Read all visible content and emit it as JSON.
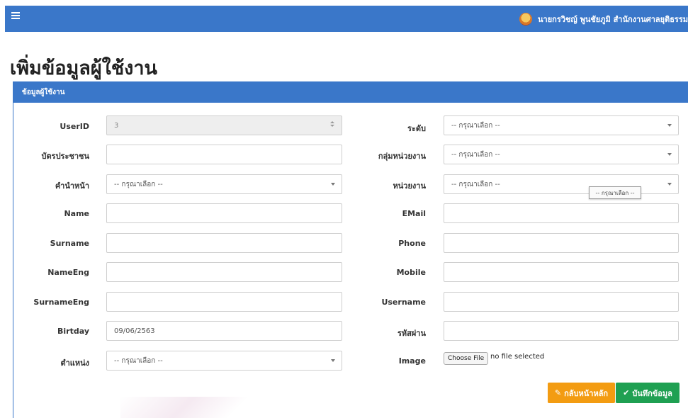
{
  "topbar": {
    "menu_icon": "hamburger-icon",
    "user_name": "นายกรวิชญ์ พูนชัยภูมิ สำนักงานศาลยุติธรรม",
    "accent": "#3a77c9"
  },
  "page": {
    "title": "เพิ่มข้อมูลผู้ใช้งาน"
  },
  "panel": {
    "heading": "ข้อมูลผู้ใช้งาน"
  },
  "form": {
    "left": [
      {
        "label": "UserID",
        "value": "3",
        "type": "number",
        "disabled": true
      },
      {
        "label": "บัตรประชาชน",
        "value": "",
        "type": "text"
      },
      {
        "label": "คำนำหน้า",
        "value": "-- กรุณาเลือก --",
        "type": "select"
      },
      {
        "label": "Name",
        "value": "",
        "type": "text"
      },
      {
        "label": "Surname",
        "value": "",
        "type": "text"
      },
      {
        "label": "NameEng",
        "value": "",
        "type": "text"
      },
      {
        "label": "SurnameEng",
        "value": "",
        "type": "text"
      },
      {
        "label": "Birtday",
        "value": "09/06/2563",
        "type": "text"
      },
      {
        "label": "ตำแหน่ง",
        "value": "-- กรุณาเลือก --",
        "type": "select"
      }
    ],
    "right": [
      {
        "label": "ระดับ",
        "value": "-- กรุณาเลือก --",
        "type": "select"
      },
      {
        "label": "กลุ่มหน่วยงาน",
        "value": "-- กรุณาเลือก --",
        "type": "select"
      },
      {
        "label": "หน่วยงาน",
        "value": "-- กรุณาเลือก --",
        "type": "select"
      },
      {
        "label": "EMail",
        "value": "",
        "type": "text"
      },
      {
        "label": "Phone",
        "value": "",
        "type": "text"
      },
      {
        "label": "Mobile",
        "value": "",
        "type": "text"
      },
      {
        "label": "Username",
        "value": "",
        "type": "text"
      },
      {
        "label": "รหัสผ่าน",
        "value": "",
        "type": "text"
      },
      {
        "label": "Image",
        "type": "file"
      }
    ],
    "tooltip": "-- กรุณาเลือก --",
    "file": {
      "button": "Choose File",
      "status": "no file selected"
    }
  },
  "actions": {
    "back_label": "กลับหน้าหลัก",
    "back_icon": "edit-icon",
    "back_color": "#f39c12",
    "save_label": "บันทึกข้อมูล",
    "save_icon": "check-icon",
    "save_color": "#1fa052"
  }
}
